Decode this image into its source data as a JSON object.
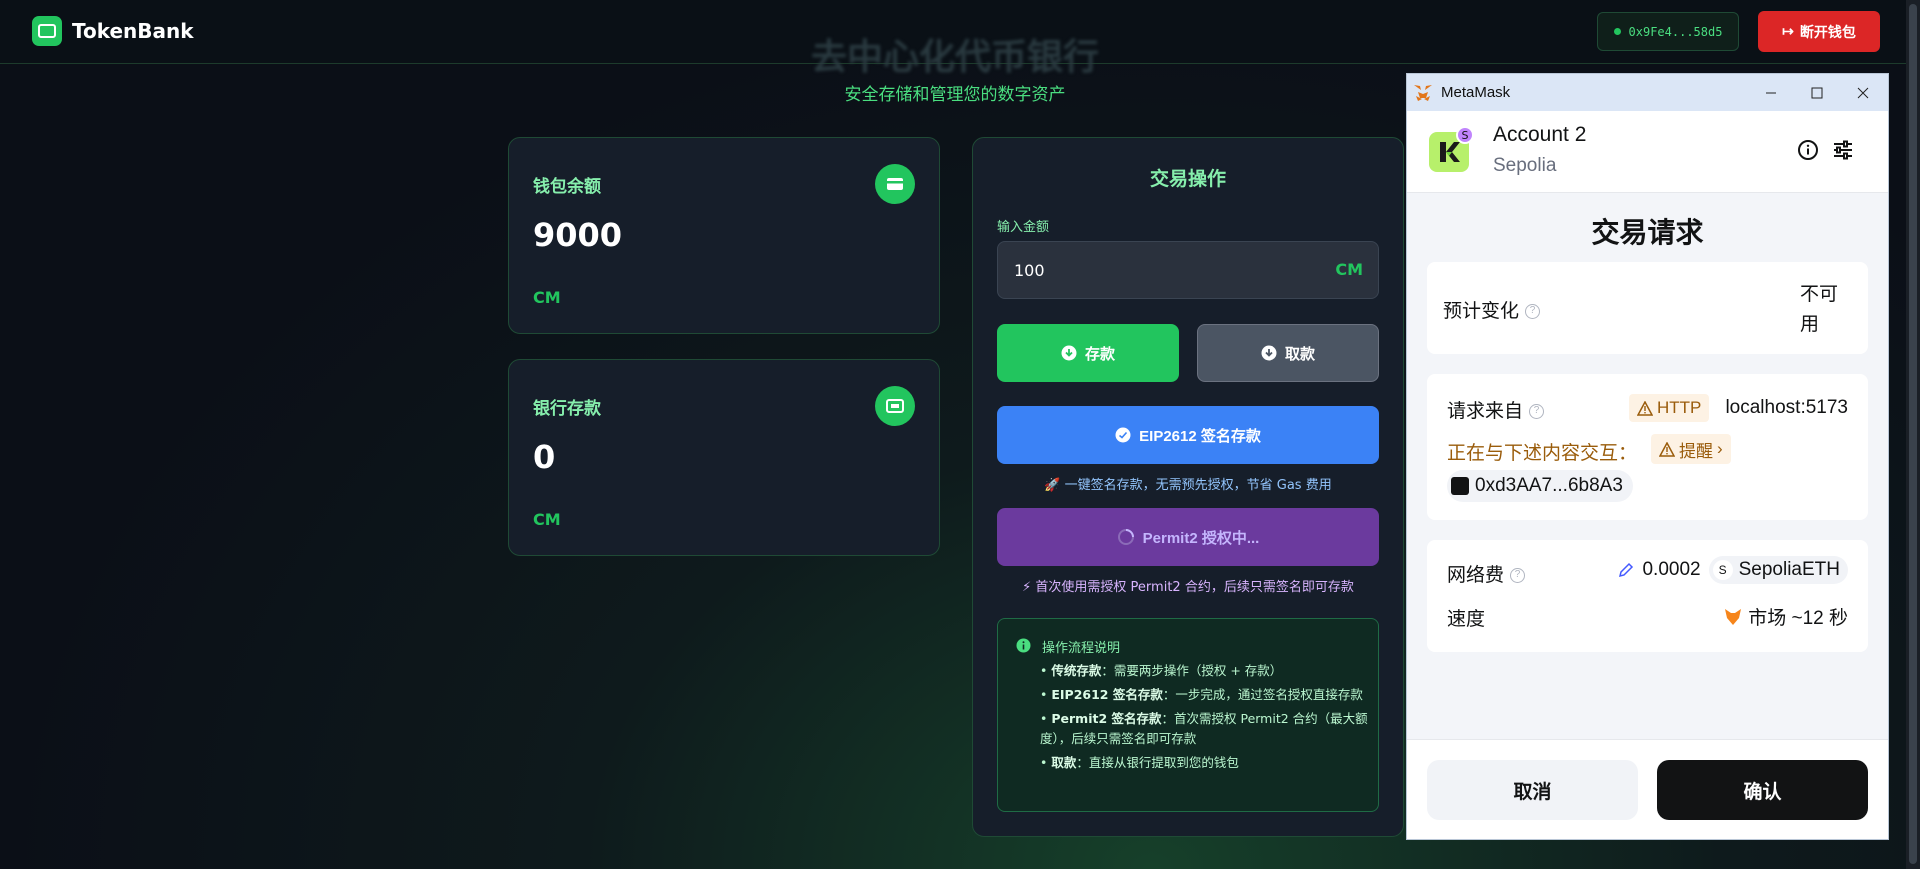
{
  "header": {
    "brand": "TokenBank",
    "address": "0x9Fe4...58d5",
    "disconnect_label": "断开钱包"
  },
  "hero": {
    "title": "去中心化代币银行",
    "subtitle": "安全存储和管理您的数字资产"
  },
  "wallet_card": {
    "label": "钱包余额",
    "value": "9000",
    "unit": "CM",
    "icon": "credit-card-icon"
  },
  "bank_card": {
    "label": "银行存款",
    "value": "0",
    "unit": "CM",
    "icon": "bank-icon"
  },
  "operations": {
    "title": "交易操作",
    "input_label": "输入金额",
    "input_value": "100",
    "input_unit": "CM",
    "deposit_label": "存款",
    "withdraw_label": "取款",
    "eip_label": "EIP2612 签名存款",
    "eip_note": "🚀 一键签名存款，无需预先授权，节省 Gas 费用",
    "permit_label": "Permit2 授权中...",
    "permit_note": "⚡ 首次使用需授权 Permit2 合约，后续只需签名即可存款",
    "flow": {
      "title": "操作流程说明",
      "items": [
        {
          "key": "传统存款",
          "text": "：需要两步操作（授权 + 存款）"
        },
        {
          "key": "EIP2612 签名存款",
          "text": "：一步完成，通过签名授权直接存款"
        },
        {
          "key": "Permit2 签名存款",
          "text": "：首次需授权 Permit2 合约（最大额度），后续只需签名即可存款"
        },
        {
          "key": "取款",
          "text": "：直接从银行提取到您的钱包"
        }
      ]
    }
  },
  "metamask": {
    "window_title": "MetaMask",
    "account": "Account 2",
    "avatar_badge": "S",
    "network": "Sepolia",
    "request_title": "交易请求",
    "estimated_change_label": "预计变化",
    "estimated_change_value": "不可用",
    "origin_label": "请求来自",
    "http_tag": "HTTP",
    "origin_value": "localhost:5173",
    "interacting_label": "正在与下述内容交互：",
    "alert_tag": "提醒",
    "contract_address": "0xd3AA7...6b8A3",
    "fee_label": "网络费",
    "fee_value": "0.0002",
    "fee_token_badge": "S",
    "fee_token": "SepoliaETH",
    "speed_label": "速度",
    "speed_value": "市场 ~12 秒",
    "cancel_label": "取消",
    "confirm_label": "确认"
  }
}
